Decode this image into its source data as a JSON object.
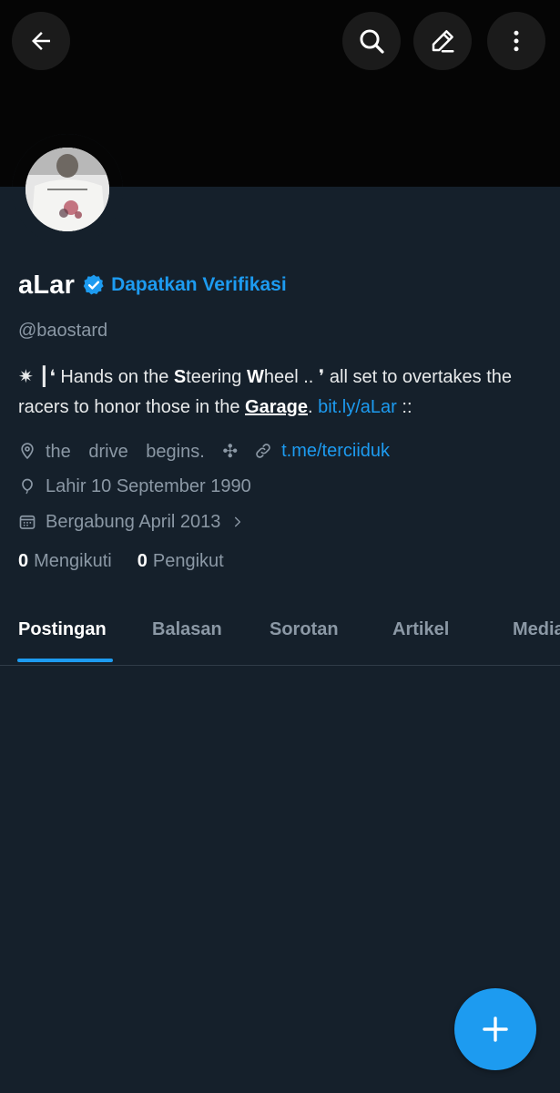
{
  "header": {
    "back_icon": "arrow-left-icon",
    "search_icon": "search-icon",
    "edit_icon": "pencil-icon",
    "more_icon": "more-vertical-icon"
  },
  "profile": {
    "display_name": "aLar",
    "verify_link": "Dapatkan Verifikasi",
    "handle": "@baostard",
    "bio": {
      "prefix": "✷ ┃❛ Hands on the ",
      "bold_s": "S",
      "teering": "teering ",
      "bold_w": "W",
      "heel": "heel .. ❜ all set to overtakes the racers to honor those in the ",
      "garage": "Garage",
      "period": ". ",
      "link": "bit.ly/aLar",
      "suffix": " ::"
    },
    "location": "the drive begins. ✣",
    "website": "t.me/terciiduk",
    "birth": "Lahir 10 September 1990",
    "joined": "Bergabung April 2013",
    "following_count": "0",
    "following_label": "Mengikuti",
    "followers_count": "0",
    "followers_label": "Pengikut"
  },
  "tabs": [
    {
      "label": "Postingan",
      "active": true
    },
    {
      "label": "Balasan",
      "active": false
    },
    {
      "label": "Sorotan",
      "active": false
    },
    {
      "label": "Artikel",
      "active": false
    },
    {
      "label": "Media",
      "active": false
    }
  ],
  "fab": {
    "icon": "plus-icon"
  },
  "colors": {
    "background": "#15202b",
    "banner": "#050505",
    "accent": "#1d9bf0",
    "secondary_text": "#8b98a5"
  }
}
